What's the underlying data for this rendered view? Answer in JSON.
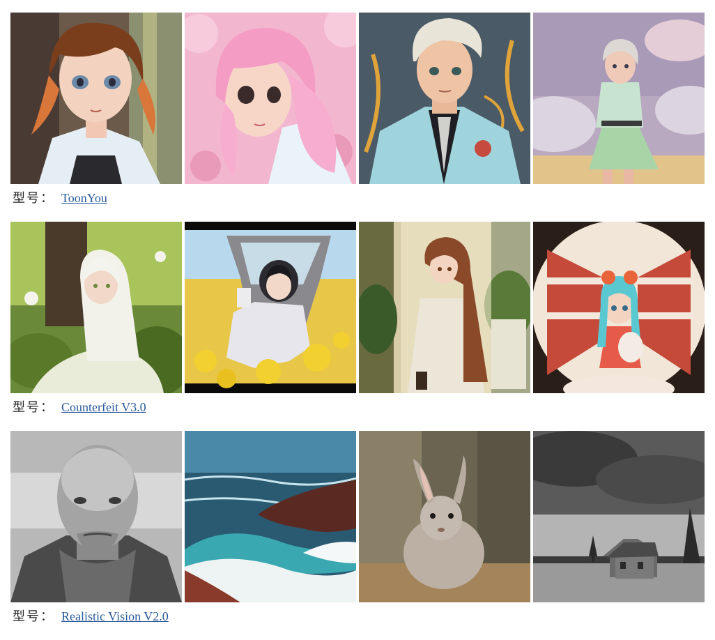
{
  "sections": [
    {
      "label_prefix": "型号：",
      "model_name": "ToonYou",
      "images": [
        {
          "subject": "anime-girl-brown-hair-portrait"
        },
        {
          "subject": "anime-girl-pink-hair-cherry-blossoms"
        },
        {
          "subject": "anime-boy-white-hair-suit"
        },
        {
          "subject": "anime-girl-green-skirt-field"
        }
      ]
    },
    {
      "label_prefix": "型号：",
      "model_name": "Counterfeit V3.0",
      "images": [
        {
          "subject": "anime-girl-white-hair-under-tree"
        },
        {
          "subject": "anime-astronaut-in-flower-field"
        },
        {
          "subject": "anime-girl-long-brown-hair-coat"
        },
        {
          "subject": "anime-girl-teal-hair-supermarket"
        }
      ]
    },
    {
      "label_prefix": "型号：",
      "model_name": "Realistic Vision V2.0",
      "images": [
        {
          "subject": "bw-portrait-bald-man-scarf"
        },
        {
          "subject": "ocean-waves-red-rocks"
        },
        {
          "subject": "rabbit-in-forest"
        },
        {
          "subject": "bw-old-house-field-clouds"
        }
      ]
    }
  ],
  "colors": {
    "link": "#2a5a9a",
    "text": "#222222",
    "background": "#ffffff"
  }
}
